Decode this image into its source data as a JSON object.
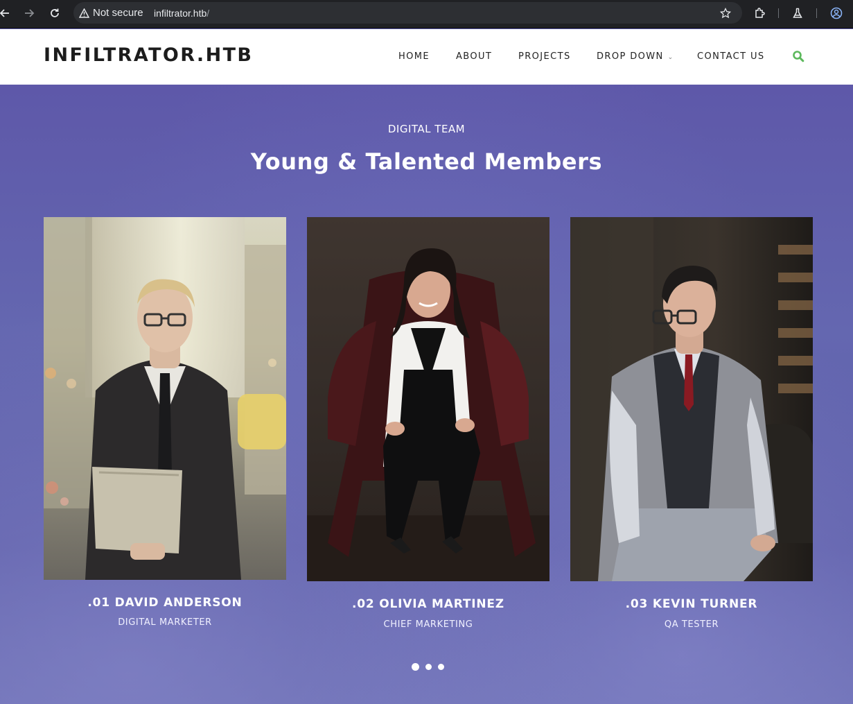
{
  "browser": {
    "security_label": "Not secure",
    "url_host": "infiltrator.htb",
    "url_path": "/"
  },
  "site": {
    "logo": "INFILTRATOR.HTB",
    "nav": [
      {
        "label": "HOME"
      },
      {
        "label": "ABOUT"
      },
      {
        "label": "PROJECTS"
      },
      {
        "label": "DROP DOWN"
      },
      {
        "label": "CONTACT US"
      }
    ],
    "accent_color": "#5cb85c"
  },
  "team": {
    "eyebrow": "DIGITAL TEAM",
    "title": "Young & Talented Members",
    "members": [
      {
        "name": ".01 DAVID ANDERSON",
        "role": "DIGITAL MARKETER"
      },
      {
        "name": ".02 OLIVIA MARTINEZ",
        "role": "CHIEF MARKETING"
      },
      {
        "name": ".03 KEVIN TURNER",
        "role": "QA TESTER"
      }
    ],
    "carousel_pages": 3,
    "carousel_active": 1
  }
}
